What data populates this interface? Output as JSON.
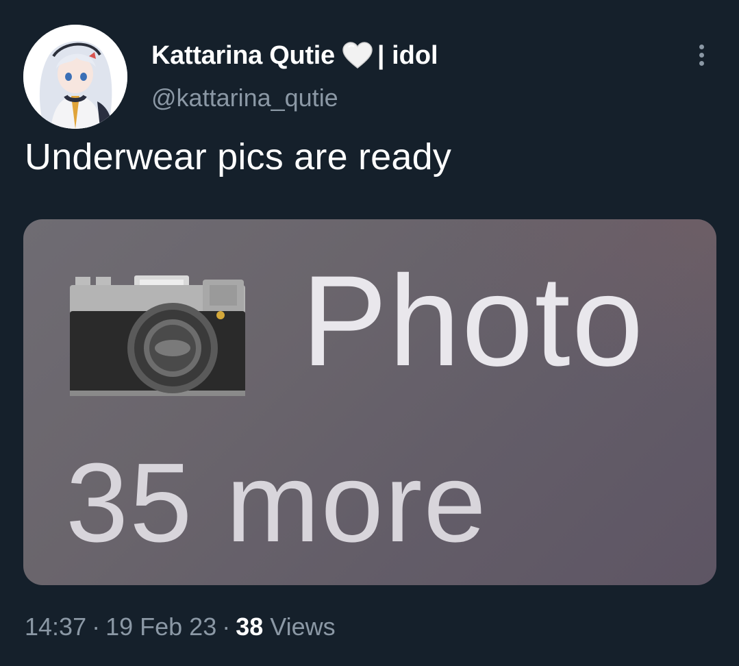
{
  "author": {
    "display_name": "Kattarina Qutie",
    "name_suffix": "| idol",
    "handle": "@kattarina_qutie",
    "badge_icon": "white-heart-icon"
  },
  "tweet": {
    "text": "Underwear pics are ready"
  },
  "media": {
    "icon": "camera-icon",
    "title": "Photo",
    "subtitle": "35 more"
  },
  "meta": {
    "time": "14:37",
    "separator": "·",
    "date": "19 Feb 23",
    "views_count": "38",
    "views_label": "Views"
  },
  "colors": {
    "background": "#15202b",
    "secondary_text": "#8b98a5",
    "primary_text": "#ffffff"
  }
}
